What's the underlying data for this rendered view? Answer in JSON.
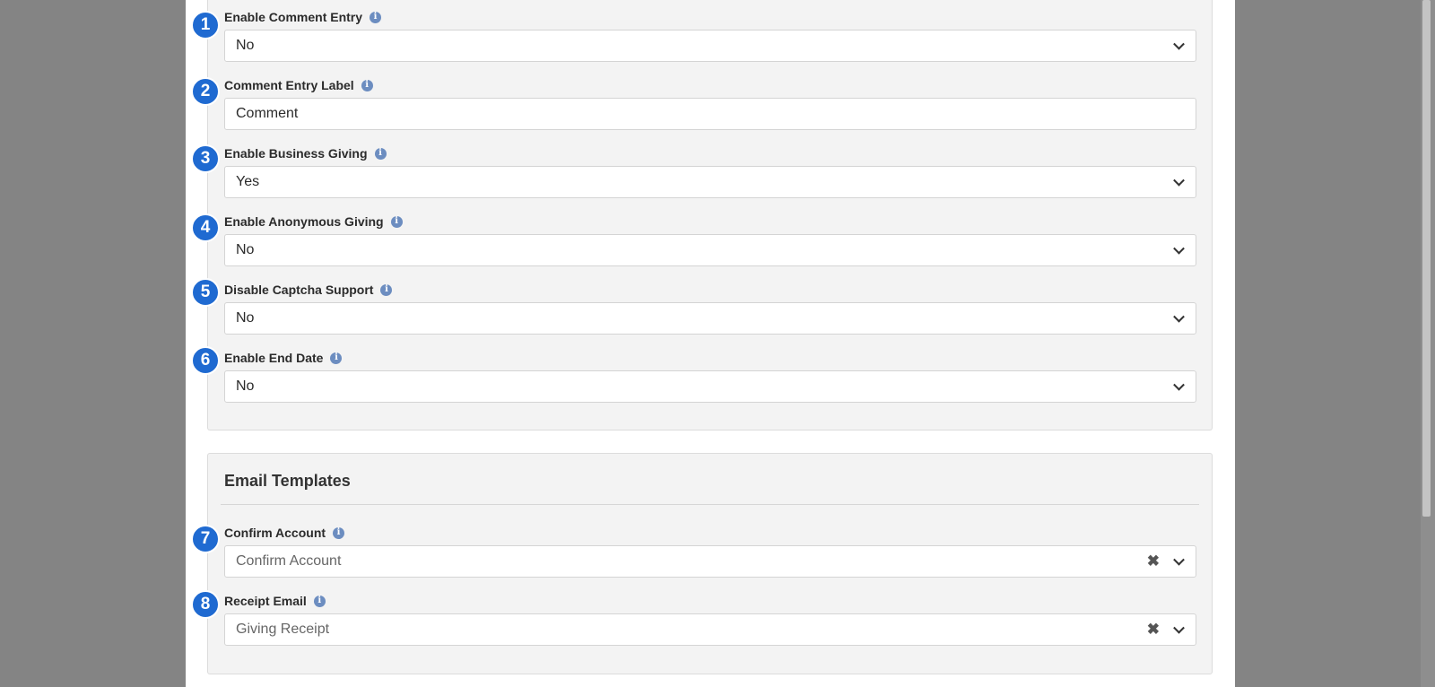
{
  "settings": {
    "fields": [
      {
        "number": "1",
        "label": "Enable Comment Entry",
        "value": "No",
        "type": "select"
      },
      {
        "number": "2",
        "label": "Comment Entry Label",
        "value": "Comment",
        "type": "text"
      },
      {
        "number": "3",
        "label": "Enable Business Giving",
        "value": "Yes",
        "type": "select"
      },
      {
        "number": "4",
        "label": "Enable Anonymous Giving",
        "value": "No",
        "type": "select"
      },
      {
        "number": "5",
        "label": "Disable Captcha Support",
        "value": "No",
        "type": "select"
      },
      {
        "number": "6",
        "label": "Enable End Date",
        "value": "No",
        "type": "select"
      }
    ]
  },
  "email_templates": {
    "title": "Email Templates",
    "fields": [
      {
        "number": "7",
        "label": "Confirm Account",
        "value": "Confirm Account",
        "type": "picker"
      },
      {
        "number": "8",
        "label": "Receipt Email",
        "value": "Giving Receipt",
        "type": "picker"
      }
    ]
  },
  "icons": {
    "info": "i",
    "clear": "✖"
  },
  "colors": {
    "badge": "#1f6ad1",
    "info_icon": "#6c8dc0",
    "overlay": "#848484"
  }
}
